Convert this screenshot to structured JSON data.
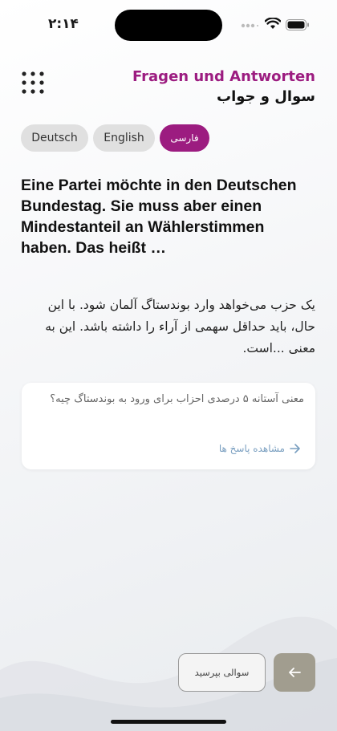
{
  "status_bar": {
    "time": "۲:۱۴"
  },
  "header": {
    "title_de": "Fragen und Antworten",
    "title_fa": "سوال و جواب"
  },
  "languages": [
    {
      "label": "Deutsch",
      "active": false
    },
    {
      "label": "English",
      "active": false
    },
    {
      "label": "فارسی",
      "active": true
    }
  ],
  "question": {
    "german": " Eine Partei möchte in den Deutschen Bundestag. Sie muss aber einen Mindestanteil an Wählerstimmen haben. Das heißt …",
    "persian": "یک حزب می‌خواهد وارد بوندستاگ آلمان شود. با این حال، باید حداقل سهمی از آراء را داشته باشد. این به معنی ...است."
  },
  "card": {
    "text": "معنی آستانه ۵ درصدی احزاب برای ورود به بوندستاگ چیه؟",
    "link_label": "مشاهده پاسخ ها"
  },
  "footer": {
    "ask_label": "سوالی بپرسید"
  },
  "colors": {
    "accent": "#9c1c80",
    "back_button": "#a19d8f"
  }
}
